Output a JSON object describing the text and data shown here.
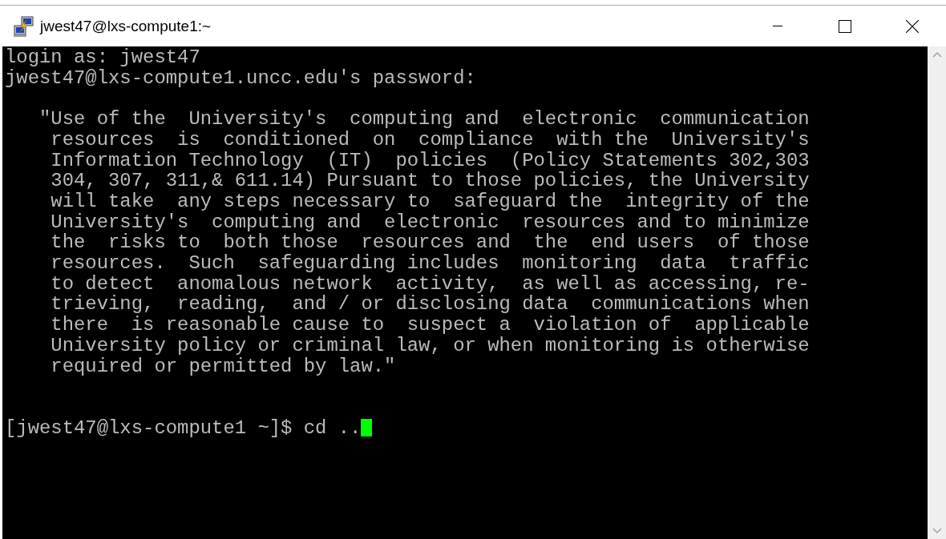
{
  "window": {
    "title": "jwest47@lxs-compute1:~"
  },
  "terminal": {
    "blocks": [
      {
        "kind": "output",
        "lines": [
          "login as: jwest47",
          "jwest47@lxs-compute1.uncc.edu's password:"
        ]
      },
      {
        "kind": "banner",
        "lines": [
          "   \"Use of the  University's  computing and  electronic  communication",
          "    resources  is  conditioned  on  compliance  with the  University's",
          "    Information Technology  (IT)  policies  (Policy Statements 302,303",
          "    304, 307, 311,& 611.14) Pursuant to those policies, the University",
          "    will take  any steps necessary to  safeguard the  integrity of the",
          "    University's  computing and  electronic  resources and to minimize",
          "    the  risks to  both those  resources and  the  end users  of those",
          "    resources.  Such  safeguarding includes  monitoring  data  traffic",
          "    to detect  anomalous network  activity,  as well as accessing, re-",
          "    trieving,  reading,  and / or disclosing data  communications when",
          "    there  is reasonable cause to  suspect a  violation of  applicable",
          "    University policy or criminal law, or when monitoring is otherwise",
          "    required or permitted by law.\""
        ]
      },
      {
        "kind": "prompt",
        "text": "[jwest47@lxs-compute1 ~]$ cd ..",
        "cursor": true
      }
    ]
  }
}
